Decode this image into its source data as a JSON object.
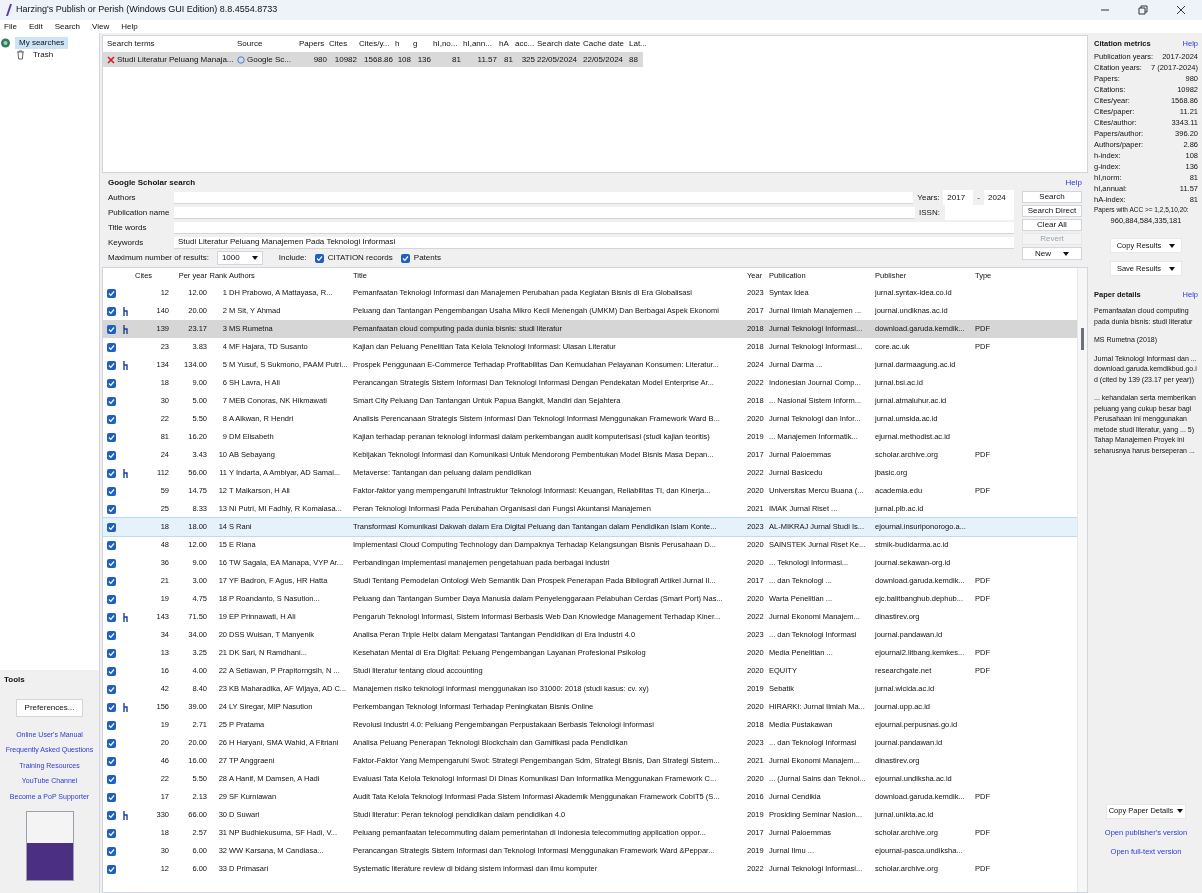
{
  "window": {
    "title": "Harzing's Publish or Perish (Windows GUI Edition) 8.8.4554.8733"
  },
  "menu": [
    "File",
    "Edit",
    "Search",
    "View",
    "Help"
  ],
  "tree": [
    {
      "label": "My searches",
      "selected": true,
      "children": [
        {
          "label": "Trash",
          "selected": false
        }
      ]
    }
  ],
  "tools": {
    "title": "Tools",
    "button": "Preferences...",
    "links": [
      "Online User's Manual",
      "Frequently Asked Questions",
      "Training Resources",
      "YouTube Channel",
      "Become a PoP Supporter"
    ]
  },
  "searches": {
    "columns": [
      "Search terms",
      "Source",
      "Papers",
      "Cites",
      "Cites/y...",
      "h",
      "g",
      "hI,no...",
      "hI,ann...",
      "hA",
      "acc...",
      "Search date",
      "Cache date",
      "Lat..."
    ],
    "rows": [
      {
        "selected": true,
        "cells": [
          "Studi Literatur Peluang Manaja...",
          "Google Sc...",
          "980",
          "10982",
          "1568.86",
          "108",
          "136",
          "81",
          "11.57",
          "81",
          "325",
          "22/05/2024",
          "22/05/2024",
          "88"
        ]
      }
    ]
  },
  "search_panel": {
    "title": "Google Scholar search",
    "help": "Help",
    "fields": [
      {
        "label": "Authors"
      },
      {
        "label": "Publication name"
      },
      {
        "label": "Title words"
      },
      {
        "label": "Keywords",
        "value": "Studi Literatur Peluang Manajemen Pada Teknologi Informasi"
      }
    ],
    "years_label": "Years:",
    "year_from": "2017",
    "year_sep": "-",
    "year_to": "2024",
    "issn_label": "ISSN:",
    "buttons": [
      {
        "label": "Search",
        "disabled": false
      },
      {
        "label": "Search Direct",
        "disabled": false
      },
      {
        "label": "Clear All",
        "disabled": false
      },
      {
        "label": "Revert",
        "disabled": true
      }
    ],
    "max_label": "Maximum number of results:",
    "max_value": "1000",
    "include_label": "Include:",
    "includes": [
      {
        "label": "CITATION records",
        "checked": true
      },
      {
        "label": "Patents",
        "checked": true
      }
    ],
    "new_button": "New"
  },
  "results": {
    "columns": [
      "Cites",
      "Per year",
      "Rank",
      "Authors",
      "Title",
      "Year",
      "Publication",
      "Publisher",
      "Type"
    ],
    "rows": [
      {
        "checked": true,
        "highly_cited": false,
        "selected": false,
        "highlighted": false,
        "cells": [
          "12",
          "12.00",
          "1",
          "DH Prabowo, A Mattayasa, R...",
          "Pemanfaatan Teknologi Informasi dan Manajemen Perubahan pada Kegiatan Bisnis di Era Globalisasi",
          "2023",
          "Syntax Idea",
          "jurnal.syntax-idea.co.id",
          ""
        ]
      },
      {
        "checked": true,
        "highly_cited": true,
        "selected": false,
        "highlighted": false,
        "cells": [
          "140",
          "20.00",
          "2",
          "M Sit, Y Ahmad",
          "Peluang dan Tantangan Pengembangan Usaha Mikro Kecil Menengah (UMKM) Dan Berbagai Aspek Ekonomi",
          "2017",
          "Jurnal Ilmiah Manajemen ...",
          "journal.undiknas.ac.id",
          ""
        ]
      },
      {
        "checked": true,
        "highly_cited": true,
        "selected": true,
        "highlighted": false,
        "cells": [
          "139",
          "23.17",
          "3",
          "MS Rumetna",
          "Pemanfaatan cloud computing pada dunia bisnis: studi literatur",
          "2018",
          "Jurnal Teknologi Informasi...",
          "download.garuda.kemdik...",
          "PDF"
        ]
      },
      {
        "checked": true,
        "highly_cited": false,
        "selected": false,
        "highlighted": false,
        "cells": [
          "23",
          "3.83",
          "4",
          "MF Hajara, TD Susanto",
          "Kajian dan Peluang Penelitian Tata Kelola Teknologi Informasi: Ulasan Literatur",
          "2018",
          "Jurnal Teknologi Informasi...",
          "core.ac.uk",
          "PDF"
        ]
      },
      {
        "checked": true,
        "highly_cited": true,
        "selected": false,
        "highlighted": false,
        "cells": [
          "134",
          "134.00",
          "5",
          "M Yusuf, S Sukmono, PAAM Putri...",
          "Prospek Penggunaan E-Commerce Terhadap Profitabilitas Dan Kemudahan Pelayanan Konsumen: Literatur...",
          "2024",
          "Jurnal Darma ...",
          "jurnal.darmaagung.ac.id",
          ""
        ]
      },
      {
        "checked": true,
        "highly_cited": false,
        "selected": false,
        "highlighted": false,
        "cells": [
          "18",
          "9.00",
          "6",
          "SH Lavra, H Ali",
          "Perancangan Strategis Sistem Informasi Dan Teknologi Informasi Dengan Pendekatan Model Enterprise Ar...",
          "2022",
          "Indonesian Journal Comp...",
          "jurnal.bsi.ac.id",
          ""
        ]
      },
      {
        "checked": true,
        "highly_cited": false,
        "selected": false,
        "highlighted": false,
        "cells": [
          "30",
          "5.00",
          "7",
          "MEB Conoras, NK Hikmawati",
          "Smart City Peluang Dan Tantangan Untuk Papua Bangkit, Mandiri dan Sejahtera",
          "2018",
          "... Nasional Sistem Inform...",
          "jurnal.atmaluhur.ac.id",
          ""
        ]
      },
      {
        "checked": true,
        "highly_cited": false,
        "selected": false,
        "highlighted": false,
        "cells": [
          "22",
          "5.50",
          "8",
          "A Alkwan, R Hendri",
          "Analisis Perencanaan Strategis Sistem Informasi Dan Teknologi Informasi Menggunakan Framework Ward B...",
          "2020",
          "Jurnal Teknologi dan Infor...",
          "jurnal.umsida.ac.id",
          ""
        ]
      },
      {
        "checked": true,
        "highly_cited": false,
        "selected": false,
        "highlighted": false,
        "cells": [
          "81",
          "16.20",
          "9",
          "DM Elisabeth",
          "Kajian terhadap peranan teknologi informasi dalam perkembangan audit komputerisasi (studi kajian teoritis)",
          "2019",
          "... Manajemen Informatik...",
          "ejurnal.methodist.ac.id",
          ""
        ]
      },
      {
        "checked": true,
        "highly_cited": false,
        "selected": false,
        "highlighted": false,
        "cells": [
          "24",
          "3.43",
          "10",
          "AB Sebayang",
          "Kebijakan Teknologi Informasi dan Komunikasi Untuk Mendorong Pembentukan Model Bisnis Masa Depan...",
          "2017",
          "Jurnal Paloemmas",
          "scholar.archive.org",
          "PDF"
        ]
      },
      {
        "checked": true,
        "highly_cited": true,
        "selected": false,
        "highlighted": false,
        "cells": [
          "112",
          "56.00",
          "11",
          "Y Indarta, A Ambiyar, AD Samal...",
          "Metaverse: Tantangan dan peluang dalam pendidikan",
          "2022",
          "Jurnal Basicedu",
          "jbasic.org",
          ""
        ]
      },
      {
        "checked": true,
        "highly_cited": false,
        "selected": false,
        "highlighted": false,
        "cells": [
          "59",
          "14.75",
          "12",
          "T Maikarson, H Ali",
          "Faktor-faktor yang mempengaruhi Infrastruktur Teknologi Informasi: Keuangan, Reliabilitas TI, dan Kinerja...",
          "2020",
          "Universitas Mercu Buana (...",
          "academia.edu",
          "PDF"
        ]
      },
      {
        "checked": true,
        "highly_cited": false,
        "selected": false,
        "highlighted": false,
        "cells": [
          "25",
          "8.33",
          "13",
          "NI Putri, MI Fadhly, R Komalasa...",
          "Peran Teknologi Informasi Pada Perubahan Organisasi dan Fungsi Akuntansi Manajemen",
          "2021",
          "IMAK Jurnal Riset ...",
          "jurnal.plb.ac.id",
          ""
        ]
      },
      {
        "checked": true,
        "highly_cited": false,
        "selected": false,
        "highlighted": true,
        "cells": [
          "18",
          "18.00",
          "14",
          "S Rani",
          "Transformasi Komunikasi Dakwah dalam Era Digital Peluang dan Tantangan dalam Pendidikan Islam Konte...",
          "2023",
          "AL-MIKRAJ Jurnal Studi Is...",
          "ejournal.insuriponorogo.a...",
          ""
        ]
      },
      {
        "checked": true,
        "highly_cited": false,
        "selected": false,
        "highlighted": false,
        "cells": [
          "48",
          "12.00",
          "15",
          "E Riana",
          "Implementasi Cloud Computing Technology dan Dampaknya Terhadap Kelangsungan Bisnis Perusahaan D...",
          "2020",
          "SAINSTEK Jurnal Riset Ke...",
          "stmik-budidarma.ac.id",
          ""
        ]
      },
      {
        "checked": true,
        "highly_cited": false,
        "selected": false,
        "highlighted": false,
        "cells": [
          "36",
          "9.00",
          "16",
          "TW Sagala, EA Manapa, VYP Ar...",
          "Perbandingan implementasi manajemen pengetahuan pada berbagai industri",
          "2020",
          "... Teknologi Informasi...",
          "journal.sekawan-org.id",
          ""
        ]
      },
      {
        "checked": true,
        "highly_cited": false,
        "selected": false,
        "highlighted": false,
        "cells": [
          "21",
          "3.00",
          "17",
          "YF Badron, F Agus, HR Hatta",
          "Studi Tentang Pemodelan Ontologi Web Semantik Dan Prospek Penerapan Pada Bibliografi Artikel Jurnal Il...",
          "2017",
          "... dan Teknologi ...",
          "download.garuda.kemdik...",
          "PDF"
        ]
      },
      {
        "checked": true,
        "highly_cited": false,
        "selected": false,
        "highlighted": false,
        "cells": [
          "19",
          "4.75",
          "18",
          "P Roandanto, S Nasution...",
          "Peluang dan Tantangan Sumber Daya Manusia dalam Penyelenggaraan Pelabuhan Cerdas (Smart Port) Nas...",
          "2020",
          "Warta Penelitian ...",
          "ejc.balitbanghub.dephub...",
          "PDF"
        ]
      },
      {
        "checked": true,
        "highly_cited": true,
        "selected": false,
        "highlighted": false,
        "cells": [
          "143",
          "71.50",
          "19",
          "EP Prinnawati, H Ali",
          "Pengaruh Teknologi Informasi, Sistem Informasi Berbasis Web Dan Knowledge Management Terhadap Kiner...",
          "2022",
          "Jurnal Ekonomi Manajem...",
          "dinastirev.org",
          ""
        ]
      },
      {
        "checked": true,
        "highly_cited": false,
        "selected": false,
        "highlighted": false,
        "cells": [
          "34",
          "34.00",
          "20",
          "DSS Wuisan, T Manyenik",
          "Analisa Peran Triple Helix dalam Mengatasi Tantangan Pendidikan di Era Industri 4.0",
          "2023",
          "... dan Teknologi Informasi",
          "journal.pandawan.id",
          ""
        ]
      },
      {
        "checked": true,
        "highly_cited": false,
        "selected": false,
        "highlighted": false,
        "cells": [
          "13",
          "3.25",
          "21",
          "DK Sari, N Ramdhani...",
          "Kesehatan Mental di Era Digital: Peluang Pengembangan Layanan Profesional Psikolog",
          "2020",
          "Media Penelitian ...",
          "ejournal2.litbang.kemkes...",
          "PDF"
        ]
      },
      {
        "checked": true,
        "highly_cited": false,
        "selected": false,
        "highlighted": false,
        "cells": [
          "16",
          "4.00",
          "22",
          "A Setiawan, P Prapitorngsih, N ...",
          "Studi literatur tentang cloud accounting",
          "2020",
          "EQUITY",
          "researchgate.net",
          "PDF"
        ]
      },
      {
        "checked": true,
        "highly_cited": false,
        "selected": false,
        "highlighted": false,
        "cells": [
          "42",
          "8.40",
          "23",
          "KB Maharadika, AF Wijaya, AD C...",
          "Manajemen risiko teknologi informasi menggunakan iso 31000: 2018 (studi kasus: cv. xy)",
          "2019",
          "Sebatik",
          "jurnal.wicida.ac.id",
          ""
        ]
      },
      {
        "checked": true,
        "highly_cited": true,
        "selected": false,
        "highlighted": false,
        "cells": [
          "156",
          "39.00",
          "24",
          "LY Siregar, MIP Nasution",
          "Perkembangan Teknologi Informasi Terhadap Peningkatan Bisnis Online",
          "2020",
          "HIRARKI: Jurnal Ilmiah Ma...",
          "journal.upp.ac.id",
          ""
        ]
      },
      {
        "checked": true,
        "highly_cited": false,
        "selected": false,
        "highlighted": false,
        "cells": [
          "19",
          "2.71",
          "25",
          "P Pratama",
          "Revolusi Industri 4.0: Peluang Pengembangan Perpustakaan Berbasis Teknologi Informasi",
          "2018",
          "Media Pustakawan",
          "ejournal.perpusnas.go.id",
          ""
        ]
      },
      {
        "checked": true,
        "highly_cited": false,
        "selected": false,
        "highlighted": false,
        "cells": [
          "20",
          "20.00",
          "26",
          "H Haryani, SMA Wahid, A Fitriani",
          "Analisa Peluang Penerapan Teknologi Blockchain dan Gamifikasi pada Pendidikan",
          "2023",
          "... dan Teknologi Informasi",
          "journal.pandawan.id",
          ""
        ]
      },
      {
        "checked": true,
        "highly_cited": false,
        "selected": false,
        "highlighted": false,
        "cells": [
          "46",
          "16.00",
          "27",
          "TP Anggraeni",
          "Faktor-Faktor Yang Mempengaruhi Swot: Strategi Pengembangan Sdm, Strategi Bisnis, Dan Strategi Sistem...",
          "2021",
          "Jurnal Ekonomi Manajem...",
          "dinastirev.org",
          ""
        ]
      },
      {
        "checked": true,
        "highly_cited": false,
        "selected": false,
        "highlighted": false,
        "cells": [
          "22",
          "5.50",
          "28",
          "A Hanif, M Damsen, A Hadi",
          "Evaluasi Tata Kelola Teknologi Informasi Di Dinas Komunikasi Dan Informatika Menggunakan Framework C...",
          "2020",
          "... (Jurnal Sains dan Teknol...",
          "ejournal.undiksha.ac.id",
          ""
        ]
      },
      {
        "checked": true,
        "highly_cited": false,
        "selected": false,
        "highlighted": false,
        "cells": [
          "17",
          "2.13",
          "29",
          "SF Kurniawan",
          "Audit Tata Kelola Teknologi Informasi Pada Sistem Informasi Akademik Menggunakan Framework CobIT5 (S...",
          "2016",
          "Jurnal Cendikia",
          "download.garuda.kemdik...",
          "PDF"
        ]
      },
      {
        "checked": true,
        "highly_cited": true,
        "selected": false,
        "highlighted": false,
        "cells": [
          "330",
          "66.00",
          "30",
          "D Suwari",
          "Studi literatur: Peran teknologi pendidikan dalam pendidikan 4.0",
          "2019",
          "Prosiding Seminar Nasion...",
          "jurnal.unikta.ac.id",
          ""
        ]
      },
      {
        "checked": true,
        "highly_cited": false,
        "selected": false,
        "highlighted": false,
        "cells": [
          "18",
          "2.57",
          "31",
          "NP Budhiekusuma, SF Hadi, V...",
          "Peluang pemanfaatan telecommuting dalam pemerintahan di indonesia telecommuting application oppor...",
          "2017",
          "Jurnal Paloemmas",
          "scholar.archive.org",
          "PDF"
        ]
      },
      {
        "checked": true,
        "highly_cited": false,
        "selected": false,
        "highlighted": false,
        "cells": [
          "30",
          "6.00",
          "32",
          "WW Karsana, M Candiasa...",
          "Perancangan Strategis Sistem Informasi dan Teknologi Informasi Menggunakan Framework Ward &Peppar...",
          "2019",
          "Jurnal Ilmu ...",
          "ejournal-pasca.undiksha...",
          ""
        ]
      },
      {
        "checked": true,
        "highly_cited": false,
        "selected": false,
        "highlighted": false,
        "cells": [
          "12",
          "6.00",
          "33",
          "D Primasari",
          "Systematic literature review di bidang sistem informasi dan ilmu komputer",
          "2022",
          "Jurnal Teknologi Informasi...",
          "scholar.archive.org",
          "PDF"
        ]
      }
    ]
  },
  "metrics": {
    "title": "Citation metrics",
    "help": "Help",
    "items": [
      {
        "label": "Publication years:",
        "value": "2017-2024"
      },
      {
        "label": "Citation years:",
        "value": "7 (2017-2024)"
      },
      {
        "label": "Papers:",
        "value": "980"
      },
      {
        "label": "Citations:",
        "value": "10982"
      },
      {
        "label": "Cites/year:",
        "value": "1568.86"
      },
      {
        "label": "Cites/paper:",
        "value": "11.21"
      },
      {
        "label": "Cites/author:",
        "value": "3343.11"
      },
      {
        "label": "Papers/author:",
        "value": "396.20"
      },
      {
        "label": "Authors/paper:",
        "value": "2.86"
      },
      {
        "label": "h-index:",
        "value": "108"
      },
      {
        "label": "g-index:",
        "value": "136"
      },
      {
        "label": "hI,norm:",
        "value": "81"
      },
      {
        "label": "hI,annual:",
        "value": "11.57"
      },
      {
        "label": "hA-index:",
        "value": "81"
      }
    ],
    "acc_label": "Papers with ACC >= 1,2,5,10,20:",
    "acc_value": "960,884,584,335,181",
    "buttons": [
      "Copy Results",
      "Save Results"
    ]
  },
  "paper_details": {
    "title": "Paper details",
    "help": "Help",
    "paragraphs": [
      "Pemanfaatan cloud computing pada dunia bisnis: studi literatur",
      "MS Rumetna (2018)",
      "Jurnal Teknologi Informasi dan ... download.garuda.kemdikbud.go.id (cited by 139 (23.17 per year))",
      "... kehandalan serta memberikan peluang yang cukup besar bagi Perusahaan ini menggunakan metode studi literatur, yang ... 5) Tahap Manajemen Proyek ini seharusnya harus berseperan ..."
    ],
    "button": "Copy Paper Details",
    "links": [
      "Open publisher's version",
      "Open full-text version"
    ]
  }
}
